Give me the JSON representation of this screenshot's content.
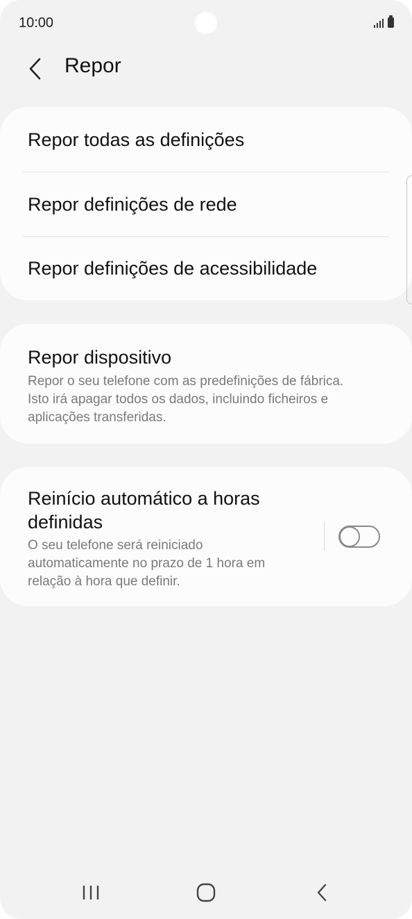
{
  "status_bar": {
    "time": "10:00",
    "icons": [
      "signal-icon",
      "battery-icon"
    ]
  },
  "header": {
    "back_icon": "chevron-left-icon",
    "title": "Repor"
  },
  "reset_options": [
    {
      "label": "Repor todas as definições"
    },
    {
      "label": "Repor definições de rede"
    },
    {
      "label": "Repor definições de acessibilidade"
    }
  ],
  "factory_reset": {
    "title": "Repor dispositivo",
    "description_lines": [
      "Repor o seu telefone com as predefinições de fábrica.",
      "Isto irá apagar todos os dados, incluindo ficheiros e",
      "aplicações transferidas."
    ]
  },
  "auto_restart": {
    "title_lines": [
      "Reinício automático a horas",
      "definidas"
    ],
    "description_lines": [
      "O seu telefone será reiniciado",
      "automaticamente no prazo de 1 hora em",
      "relação à hora que definir."
    ],
    "enabled": false
  },
  "nav_bar": {
    "icons": [
      "recent-apps-icon",
      "home-icon",
      "back-icon"
    ]
  },
  "colors": {
    "background": "#f2f2f2",
    "card": "#fcfcfc",
    "text_primary": "#111111",
    "text_secondary": "#7a7a7a"
  }
}
